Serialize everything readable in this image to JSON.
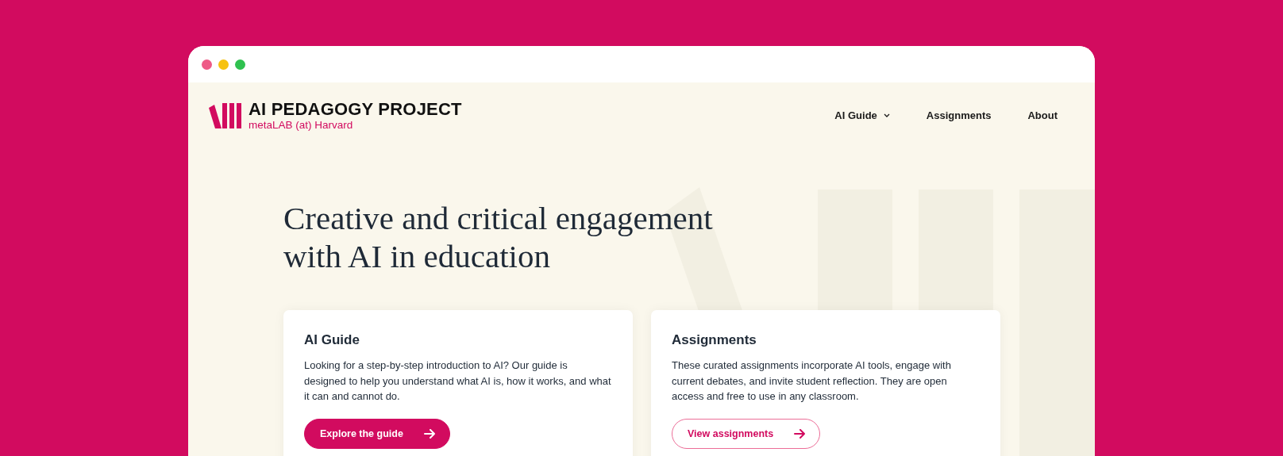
{
  "window": {
    "controls": [
      {
        "color": "#ee5a87"
      },
      {
        "color": "#f7c20e"
      },
      {
        "color": "#2fc14f"
      }
    ]
  },
  "header": {
    "logo": {
      "title": "AI PEDAGOGY PROJECT",
      "subtitle": "metaLAB (at) Harvard"
    },
    "nav": [
      {
        "label": "AI Guide",
        "kind": "dropdown"
      },
      {
        "label": "Assignments",
        "kind": "link"
      },
      {
        "label": "About",
        "kind": "link"
      }
    ]
  },
  "hero": {
    "headline": "Creative and critical engagement with AI in education"
  },
  "cards": [
    {
      "title": "AI Guide",
      "text": "Looking for a step-by-step introduction to AI? Our guide is designed to help you understand what AI is, how it works, and what it can and cannot do.",
      "button": {
        "label": "Explore the guide",
        "kind": "filled"
      }
    },
    {
      "title": "Assignments",
      "text": "These curated assignments incorporate AI tools, engage with current debates, and invite student reflection. They are open access and free to use in any classroom.",
      "button": {
        "label": "View assignments",
        "kind": "outline"
      }
    }
  ]
}
